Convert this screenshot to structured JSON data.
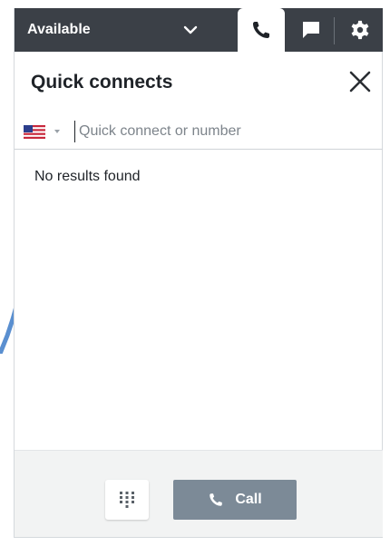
{
  "status": {
    "label": "Available"
  },
  "tabs": [
    {
      "icon": "phone-icon",
      "active": true
    },
    {
      "icon": "chat-icon",
      "active": false
    },
    {
      "icon": "gear-icon",
      "active": false
    }
  ],
  "header": {
    "title": "Quick connects"
  },
  "search": {
    "country_flag": "us-flag-icon",
    "placeholder": "Quick connect or number",
    "value": ""
  },
  "results": {
    "empty_message": "No results found"
  },
  "footer": {
    "call_label": "Call"
  },
  "colors": {
    "topbar": "#3b4047",
    "call_button": "#7c8a97",
    "footer_bg": "#f2f3f3",
    "pointer_arrow": "#5a8fd0"
  }
}
